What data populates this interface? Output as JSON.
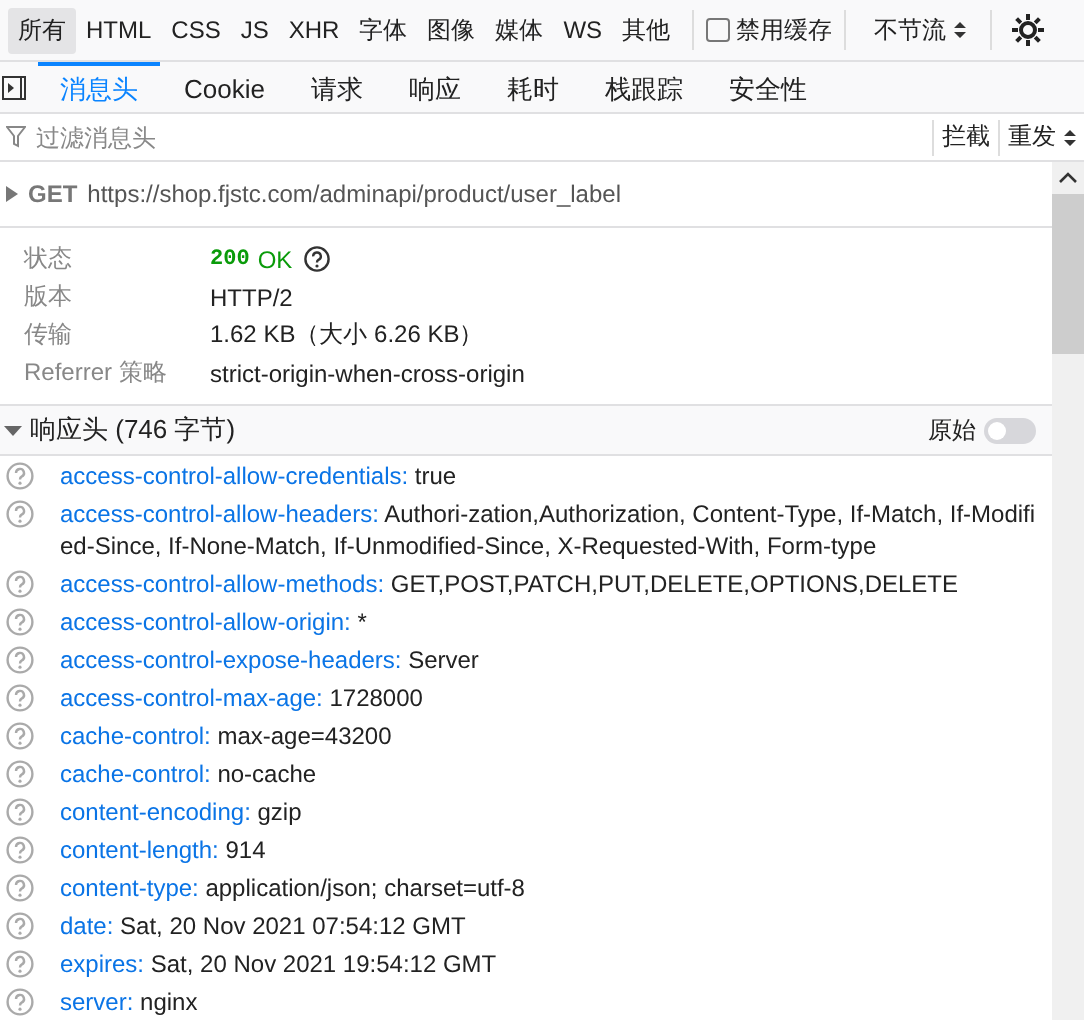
{
  "type_filters": [
    {
      "label": "所有",
      "selected": true
    },
    {
      "label": "HTML",
      "selected": false
    },
    {
      "label": "CSS",
      "selected": false
    },
    {
      "label": "JS",
      "selected": false
    },
    {
      "label": "XHR",
      "selected": false
    },
    {
      "label": "字体",
      "selected": false
    },
    {
      "label": "图像",
      "selected": false
    },
    {
      "label": "媒体",
      "selected": false
    },
    {
      "label": "WS",
      "selected": false
    },
    {
      "label": "其他",
      "selected": false
    }
  ],
  "disable_cache": {
    "label": "禁用缓存",
    "checked": false
  },
  "throttling": {
    "value": "不节流"
  },
  "tabs": [
    {
      "label": "消息头",
      "selected": true
    },
    {
      "label": "Cookie",
      "selected": false
    },
    {
      "label": "请求",
      "selected": false
    },
    {
      "label": "响应",
      "selected": false
    },
    {
      "label": "耗时",
      "selected": false
    },
    {
      "label": "栈跟踪",
      "selected": false
    },
    {
      "label": "安全性",
      "selected": false
    }
  ],
  "filter": {
    "placeholder": "过滤消息头"
  },
  "toolbar_buttons": [
    "拦截",
    "重发"
  ],
  "request": {
    "method": "GET",
    "url": "https://shop.fjstc.com/adminapi/product/user_label"
  },
  "summary": [
    {
      "label": "状态",
      "value": "OK",
      "code": "200",
      "kind": "status"
    },
    {
      "label": "版本",
      "value": "HTTP/2",
      "kind": "text"
    },
    {
      "label": "传输",
      "value": "1.62 KB（大小 6.26 KB）",
      "kind": "text"
    },
    {
      "label": "Referrer 策略",
      "value": "strict-origin-when-cross-origin",
      "kind": "text"
    }
  ],
  "response_headers": {
    "title": "响应头 (746 字节)",
    "expanded": true,
    "raw_label": "原始",
    "raw_on": false,
    "rows": [
      {
        "name": "access-control-allow-credentials:",
        "value": "true"
      },
      {
        "name": "access-control-allow-headers:",
        "value": "Authori-zation,Authorization, Content-Type, If-Match, If-Modified-Since, If-None-Match, If-Unmodified-Since, X-Requested-With, Form-type"
      },
      {
        "name": "access-control-allow-methods:",
        "value": "GET,POST,PATCH,PUT,DELETE,OPTIONS,DELETE"
      },
      {
        "name": "access-control-allow-origin:",
        "value": "*"
      },
      {
        "name": "access-control-expose-headers:",
        "value": "Server"
      },
      {
        "name": "access-control-max-age:",
        "value": "1728000"
      },
      {
        "name": "cache-control:",
        "value": "max-age=43200"
      },
      {
        "name": "cache-control:",
        "value": "no-cache"
      },
      {
        "name": "content-encoding:",
        "value": "gzip"
      },
      {
        "name": "content-length:",
        "value": "914"
      },
      {
        "name": "content-type:",
        "value": "application/json; charset=utf-8"
      },
      {
        "name": "date:",
        "value": "Sat, 20 Nov 2021 07:54:12 GMT"
      },
      {
        "name": "expires:",
        "value": "Sat, 20 Nov 2021 19:54:12 GMT"
      },
      {
        "name": "server:",
        "value": "nginx"
      }
    ]
  }
}
